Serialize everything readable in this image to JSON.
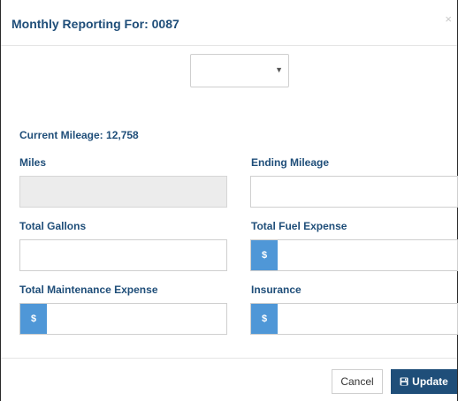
{
  "modal": {
    "title": "Monthly Reporting For: 0087",
    "close_glyph": "×"
  },
  "period_select": {
    "selected": "",
    "arrow_glyph": "▼"
  },
  "current_mileage": "Current Mileage: 12,758",
  "fields": {
    "miles": {
      "label": "Miles",
      "value": ""
    },
    "ending_mileage": {
      "label": "Ending Mileage",
      "value": ""
    },
    "total_gallons": {
      "label": "Total Gallons",
      "value": ""
    },
    "total_fuel_expense": {
      "label": "Total Fuel Expense",
      "value": "",
      "prefix": "$"
    },
    "total_maintenance_expense": {
      "label": "Total Maintenance Expense",
      "value": "",
      "prefix": "$"
    },
    "insurance": {
      "label": "Insurance",
      "value": "",
      "prefix": "$"
    }
  },
  "footer": {
    "cancel_label": "Cancel",
    "update_label": "Update"
  },
  "colors": {
    "title": "#1f4e79",
    "addon": "#4f97d7",
    "primary_button": "#1f4e79"
  },
  "icons": {
    "close": "close-icon",
    "dropdown": "chevron-down-icon",
    "update": "save-icon"
  }
}
